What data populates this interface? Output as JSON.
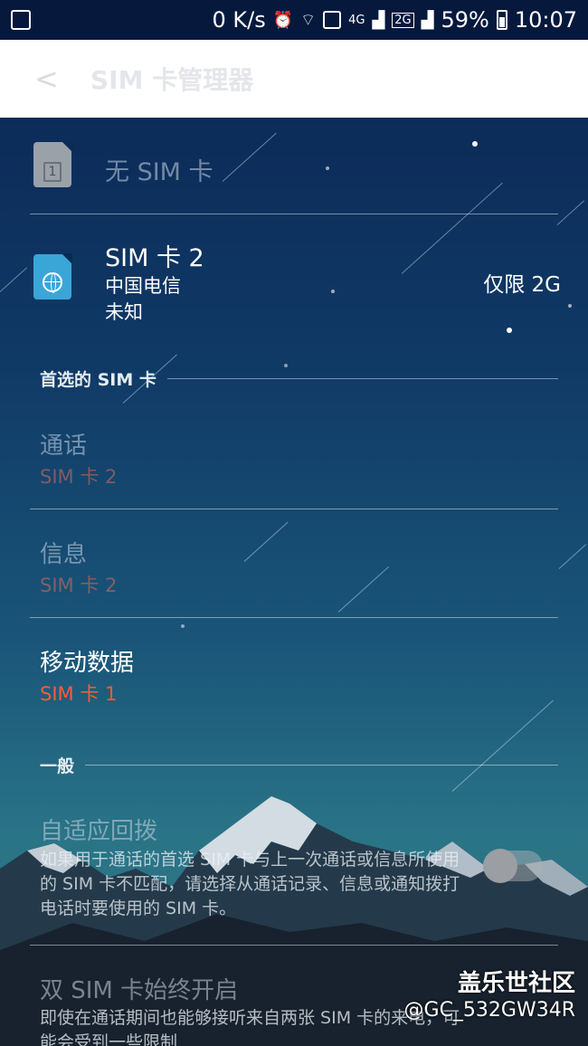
{
  "status_bar": {
    "speed": "0 K/s",
    "network": "4G",
    "network_2g": "2G",
    "battery": "59%",
    "time": "10:07",
    "icons": [
      "notification-icon",
      "alarm-icon",
      "wifi-icon",
      "browser-icon",
      "signal-icon",
      "battery-icon"
    ]
  },
  "app_bar": {
    "back": "<",
    "title": "SIM 卡管理器"
  },
  "sims": [
    {
      "name": "无 SIM 卡",
      "slot": "1"
    },
    {
      "name": "SIM 卡 2",
      "carrier": "中国电信",
      "status": "未知",
      "network_mode": "仅限 2G"
    }
  ],
  "preferred": {
    "header": "首选的 SIM 卡",
    "call": {
      "title": "通话",
      "value": "SIM 卡 2"
    },
    "message": {
      "title": "信息",
      "value": "SIM 卡 2"
    },
    "data": {
      "title": "移动数据",
      "value": "SIM 卡 1"
    }
  },
  "general": {
    "header": "一般",
    "adaptive": {
      "title": "自适应回拨",
      "desc": "如果用于通话的首选 SIM 卡与上一次通话或信息所使用的 SIM 卡不匹配，请选择从通话记录、信息或通知拨打电话时要使用的 SIM 卡。"
    },
    "dual": {
      "title": "双 SIM 卡始终开启",
      "desc": "即使在通话期间也能够接听来自两张 SIM 卡的来电，可能会受到一些限制"
    }
  },
  "watermark": {
    "name": "盖乐世社区",
    "user": "@GC_532GW34R"
  },
  "colors": {
    "accent_red": "#ff5a36",
    "app_bar_bg": "#ffffff",
    "status_bg": "#06193d"
  }
}
